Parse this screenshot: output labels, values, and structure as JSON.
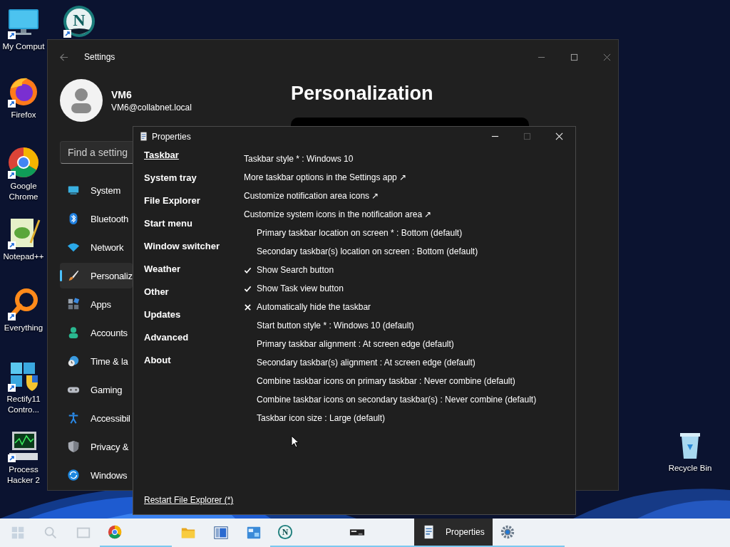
{
  "desktop_icons": [
    {
      "kind": "computer",
      "label": "My Comput"
    },
    {
      "kind": "netscape",
      "glyph": "N"
    },
    {
      "kind": "firefox",
      "label": "Firefox"
    },
    {
      "kind": "chrome",
      "label": "Google Chrome"
    },
    {
      "kind": "notepad",
      "label": "Notepad++"
    },
    {
      "kind": "everything",
      "label": "Everything"
    },
    {
      "kind": "rectify",
      "label": "Rectify11 Contro..."
    },
    {
      "kind": "processhacker",
      "label": "Process Hacker 2"
    },
    {
      "kind": "recyclebin",
      "label": "Recycle Bin"
    }
  ],
  "settings_window": {
    "title": "Settings",
    "user": {
      "name": "VM6",
      "email": "VM6@collabnet.local"
    },
    "search": {
      "placeholder": "Find a setting"
    },
    "nav": [
      {
        "kind": "system",
        "label": "System",
        "selected": false
      },
      {
        "kind": "bluetooth",
        "label": "Bluetooth",
        "selected": false
      },
      {
        "kind": "network",
        "label": "Network",
        "selected": false
      },
      {
        "kind": "personalization",
        "label": "Personaliz",
        "selected": true
      },
      {
        "kind": "apps",
        "label": "Apps",
        "selected": false
      },
      {
        "kind": "accounts",
        "label": "Accounts",
        "selected": false
      },
      {
        "kind": "time",
        "label": "Time & la",
        "selected": false
      },
      {
        "kind": "gaming",
        "label": "Gaming",
        "selected": false
      },
      {
        "kind": "accessibility",
        "label": "Accessibil",
        "selected": false
      },
      {
        "kind": "privacy",
        "label": "Privacy &",
        "selected": false
      },
      {
        "kind": "update",
        "label": "Windows",
        "selected": false
      }
    ],
    "page_title": "Personalization"
  },
  "properties_window": {
    "title": "Properties",
    "tabs": [
      {
        "label": "Taskbar",
        "selected": true
      },
      {
        "label": "System tray",
        "selected": false
      },
      {
        "label": "File Explorer",
        "selected": false
      },
      {
        "label": "Start menu",
        "selected": false
      },
      {
        "label": "Window switcher",
        "selected": false
      },
      {
        "label": "Weather",
        "selected": false
      },
      {
        "label": "Other",
        "selected": false
      },
      {
        "label": "Updates",
        "selected": false
      },
      {
        "label": "Advanced",
        "selected": false
      },
      {
        "label": "About",
        "selected": false
      }
    ],
    "items": [
      {
        "kind": "option",
        "label": "Taskbar style * : Windows 10"
      },
      {
        "kind": "link",
        "label": "More taskbar options in the Settings app ↗"
      },
      {
        "kind": "link",
        "label": "Customize notification area icons ↗"
      },
      {
        "kind": "link",
        "label": "Customize system icons in the notification area ↗"
      },
      {
        "kind": "sub-option",
        "label": "Primary taskbar location on screen * : Bottom (default)"
      },
      {
        "kind": "sub-option",
        "label": "Secondary taskbar(s) location on screen : Bottom (default)"
      },
      {
        "kind": "toggle",
        "label": "Show Search button",
        "checked": true
      },
      {
        "kind": "toggle",
        "label": "Show Task view button",
        "checked": true
      },
      {
        "kind": "toggle",
        "label": "Automatically hide the taskbar",
        "checked": false
      },
      {
        "kind": "sub-option",
        "label": "Start button style * : Windows 10 (default)"
      },
      {
        "kind": "sub-option",
        "label": "Primary taskbar alignment : At screen edge (default)"
      },
      {
        "kind": "sub-option",
        "label": "Secondary taskbar(s) alignment : At screen edge (default)"
      },
      {
        "kind": "sub-option",
        "label": "Combine taskbar icons on primary taskbar : Never combine (default)"
      },
      {
        "kind": "sub-option",
        "label": "Combine taskbar icons on secondary taskbar(s) : Never combine (default)"
      },
      {
        "kind": "sub-option",
        "label": "Taskbar icon size : Large (default)"
      }
    ],
    "footer_link": "Restart File Explorer (*)"
  },
  "taskbar": {
    "items": [
      {
        "kind": "start",
        "running": false,
        "selected": false
      },
      {
        "kind": "search",
        "running": false,
        "selected": false
      },
      {
        "kind": "taskview",
        "running": false,
        "selected": false
      },
      {
        "kind": "chrome",
        "running": true,
        "selected": false
      },
      {
        "kind": "explorer",
        "running": false,
        "selected": false
      },
      {
        "kind": "app",
        "running": false,
        "selected": false
      },
      {
        "kind": "controlpanel",
        "running": false,
        "selected": false
      },
      {
        "kind": "netscape",
        "glyph": "N",
        "running": true,
        "selected": false
      },
      {
        "kind": "terminal",
        "running": true,
        "selected": false
      },
      {
        "kind": "properties",
        "label": "Properties",
        "running": true,
        "selected": true
      },
      {
        "kind": "settings",
        "running": true,
        "selected": false
      }
    ]
  }
}
